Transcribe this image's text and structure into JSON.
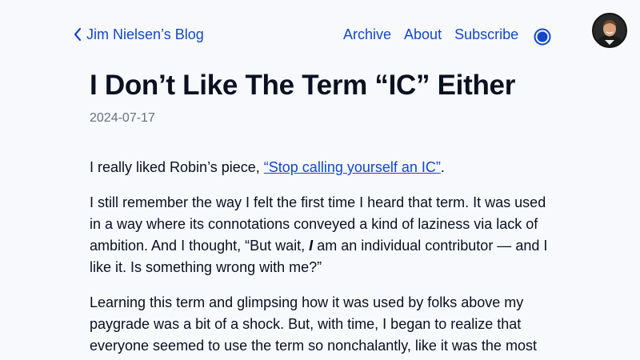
{
  "header": {
    "back_label": "Jim Nielsen’s Blog",
    "nav": {
      "archive": "Archive",
      "about": "About",
      "subscribe": "Subscribe"
    }
  },
  "article": {
    "title": "I Don’t Like The Term “IC” Either",
    "date": "2024-07-17",
    "p1_before": "I really liked Robin’s piece, ",
    "p1_link": "“Stop calling yourself an IC”",
    "p1_after": ".",
    "p2_before": "I still remember the way I felt the first time I heard that term. It was used in a way where its connotations conveyed a kind of laziness via lack of ambition. And I thought, “But wait, ",
    "p2_em": "I",
    "p2_after": " am an individual contributor — and I like it. Is something wrong with me?”",
    "p3": "Learning this term and glimpsing how it was used by folks above my paygrade was a bit of a shock. But, with time, I began to realize that everyone seemed to use the term so nonchalantly, like it was the most"
  },
  "colors": {
    "background": "#f7f9fd",
    "link": "#1447c8",
    "text": "#0b1020",
    "muted": "#6b6f7a"
  },
  "icons": {
    "back": "chevron-left-icon",
    "theme": "theme-toggle-icon"
  }
}
